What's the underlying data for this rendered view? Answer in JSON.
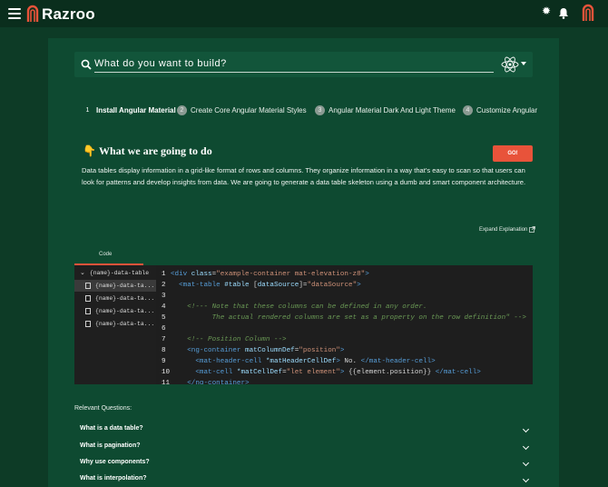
{
  "app": {
    "brand": "Razroo",
    "brand_color": "#e8533a"
  },
  "header": {
    "menu_icon": "hamburger-menu-icon",
    "settings_icon": "gear-icon",
    "notification_icon": "bell-icon"
  },
  "search": {
    "placeholder": "What do you want to build?",
    "value": "",
    "framework_icon": "react-icon"
  },
  "steps": [
    {
      "number": "1",
      "label": "Install Angular Material",
      "active": true
    },
    {
      "number": "2",
      "label": "Create Core Angular Material Styles",
      "active": false
    },
    {
      "number": "3",
      "label": "Angular Material Dark And Light Theme",
      "active": false
    },
    {
      "number": "4",
      "label": "Customize Angular",
      "active": false
    }
  ],
  "section": {
    "icon": "👇",
    "title": "What we are going to do",
    "go_label": "GO!",
    "description": "Data tables display information in a grid-like format of rows and columns. They organize information in a way that's easy to scan so that users can look for patterns and develop insights from data. We are going to generate a data table skeleton using a dumb and smart component architecture.",
    "expand_label": "Expand Explanation"
  },
  "code_panel": {
    "tab_label": "Code",
    "folder": "{name}-data-table",
    "files": [
      "{name}-data-ta...",
      "{name}-data-ta...",
      "{name}-data-ta...",
      "{name}-data-ta..."
    ],
    "line_numbers": [
      "1",
      "2",
      "3",
      "4",
      "5",
      "6",
      "7",
      "8",
      "9",
      "10",
      "11"
    ]
  },
  "questions": {
    "title": "Relevant Questions:",
    "items": [
      "What is a data table?",
      "What is pagination?",
      "Why use components?",
      "What is interpolation?"
    ]
  }
}
